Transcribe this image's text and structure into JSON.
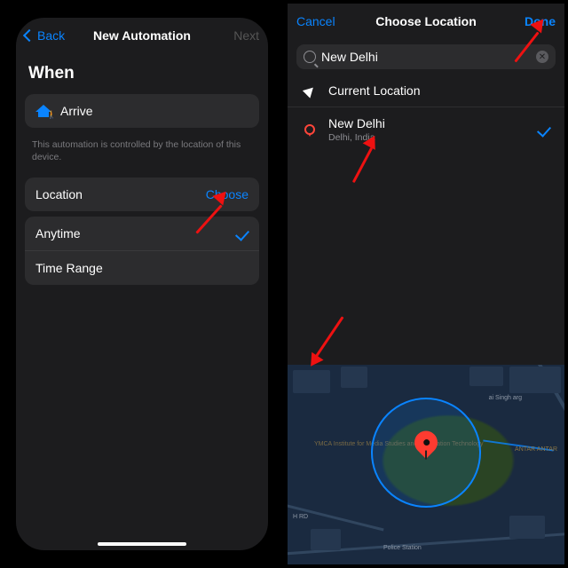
{
  "left": {
    "nav": {
      "back": "Back",
      "title": "New Automation",
      "next": "Next"
    },
    "when": "When",
    "arrive": "Arrive",
    "caption": "This automation is controlled by the location of this device.",
    "location_label": "Location",
    "choose": "Choose",
    "anytime": "Anytime",
    "timerange": "Time Range"
  },
  "right": {
    "nav": {
      "cancel": "Cancel",
      "title": "Choose Location",
      "done": "Done"
    },
    "search_value": "New Delhi",
    "current": "Current Location",
    "result": {
      "title": "New Delhi",
      "subtitle": "Delhi, India"
    },
    "map_labels": {
      "ymca": "YMCA Institute\nfor Media\nStudies and\nInformation\nTechnology",
      "police": "Police Station",
      "jantar": "ANTAR\nANTAR",
      "singh": "ai Singh\narg",
      "road": "H RD"
    }
  }
}
